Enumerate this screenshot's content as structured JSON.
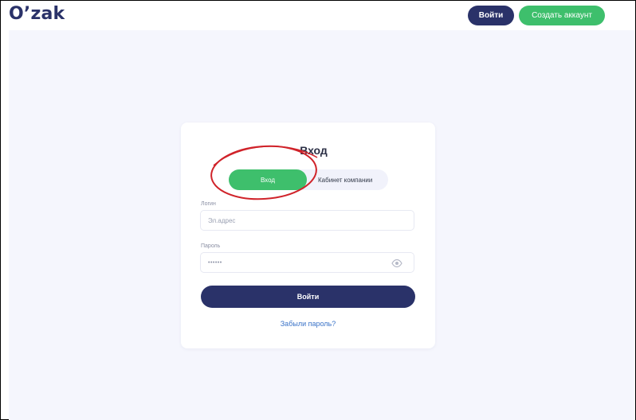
{
  "header": {
    "logo": "O’zak",
    "login_button": "Войти",
    "register_button": "Создать аккаунт"
  },
  "card": {
    "title": "Вход",
    "tabs": [
      {
        "label": "Вход",
        "active": true
      },
      {
        "label": "Кабинет компании",
        "active": false
      }
    ],
    "login": {
      "label": "Логин",
      "placeholder": "Эл.адрес"
    },
    "password": {
      "label": "Пароль",
      "value": "••••••",
      "toggle_icon": "eye-icon"
    },
    "submit_button": "Войти",
    "forgot_link": "Забыли пароль?"
  },
  "colors": {
    "brand_dark": "#2a3269",
    "brand_green": "#3ebf6c",
    "page_background": "#f5f6fd",
    "link": "#3a73c8",
    "annotation_circle": "#d0232a"
  }
}
